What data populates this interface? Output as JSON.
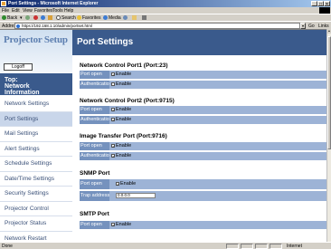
{
  "window": {
    "title": "Port Settings - Microsoft Internet Explorer",
    "controls": [
      "_",
      "□",
      "✕"
    ]
  },
  "menu": [
    "File",
    "Edit",
    "View",
    "Favorites",
    "Tools",
    "Help"
  ],
  "toolbar": {
    "back": "Back",
    "search": "Search",
    "favorites": "Favorites",
    "media": "Media"
  },
  "address": {
    "label": "Address",
    "url": "https://192.168.1.10/admin/portset.html",
    "go": "Go",
    "links": "Links"
  },
  "sidebar": {
    "logo": "Projector Setup",
    "logoff": "Logoff",
    "top_block": [
      "Top:",
      "Network",
      "Information"
    ],
    "items": [
      {
        "label": "Network Settings"
      },
      {
        "label": "Port Settings"
      },
      {
        "label": "Mail Settings"
      },
      {
        "label": "Alert Settings"
      },
      {
        "label": "Schedule Settings"
      },
      {
        "label": "Date/Time Settings"
      },
      {
        "label": "Security Settings"
      },
      {
        "label": "Projector Control"
      },
      {
        "label": "Projector Status"
      },
      {
        "label": "Network Restart"
      }
    ]
  },
  "page": {
    "title": "Port Settings",
    "sections": [
      {
        "title": "Network Control Port1 (Port:23)",
        "rows": [
          {
            "label": "Port open",
            "option": "Enable",
            "checked": true
          },
          {
            "label": "Authentication",
            "option": "Enable",
            "checked": false
          }
        ]
      },
      {
        "title": "Network Control Port2 (Port:9715)",
        "rows": [
          {
            "label": "Port open",
            "option": "Enable",
            "checked": true
          },
          {
            "label": "Authentication",
            "option": "Enable",
            "checked": true
          }
        ]
      },
      {
        "title": "Image Transfer Port (Port:9716)",
        "rows": [
          {
            "label": "Port open",
            "option": "Enable",
            "checked": true
          },
          {
            "label": "Authentication",
            "option": "Enable",
            "checked": true
          }
        ]
      },
      {
        "title": "SNMP Port",
        "rows": [
          {
            "label": "Port open",
            "option": "Enable",
            "checked": true
          },
          {
            "label": "Trap address",
            "value": "0.0.0.0"
          }
        ]
      },
      {
        "title": "SMTP Port",
        "rows": [
          {
            "label": "Port open",
            "option": "Enable",
            "checked": true
          }
        ]
      }
    ]
  },
  "status": {
    "text": "Done",
    "zone": "Internet"
  },
  "colors": {
    "nav_header": "#3a5a8c",
    "row_bg": "#9db3d6",
    "label_bg": "#7592be",
    "active_nav": "#c9d6ea"
  }
}
